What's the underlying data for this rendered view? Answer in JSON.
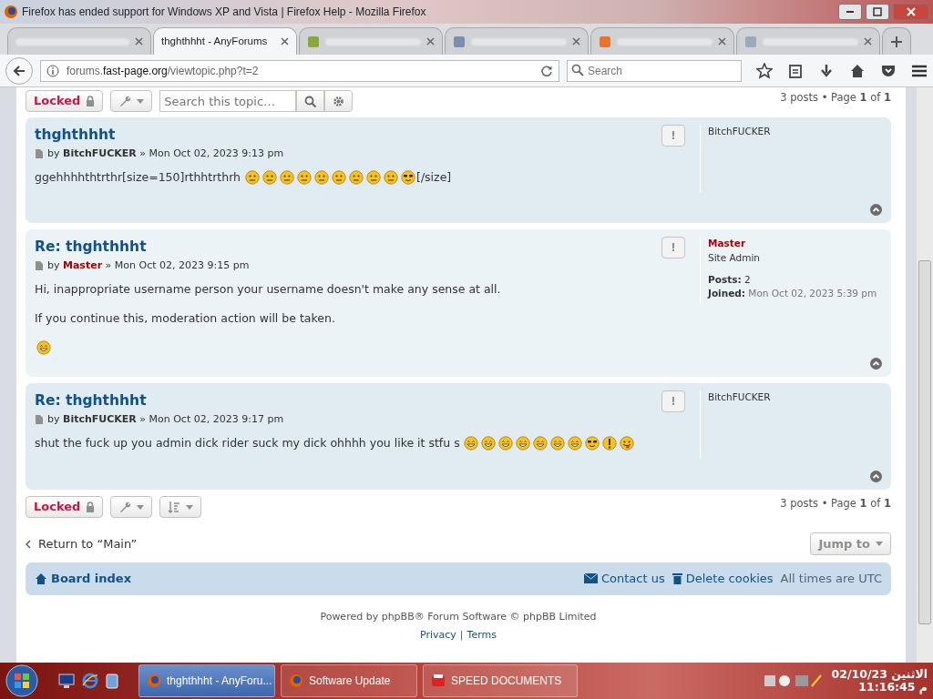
{
  "window": {
    "title": "Firefox has ended support for Windows XP and Vista | Firefox Help - Mozilla Firefox"
  },
  "tabs": [
    {
      "selected": false
    },
    {
      "title": "thghthhht - AnyForums",
      "selected": true
    },
    {
      "selected": false
    },
    {
      "selected": false
    },
    {
      "selected": false
    },
    {
      "selected": false
    }
  ],
  "address": {
    "domain_pre": "forums.",
    "domain": "fast-page.org",
    "path": "/viewtopic.php?t=2"
  },
  "search": {
    "placeholder": "Search"
  },
  "top_actions": {
    "locked": "Locked",
    "search_placeholder": "Search this topic…",
    "pagination": "3 posts • Page **1** of **1**"
  },
  "posts": [
    {
      "title": "thghthhht",
      "report": "!",
      "by_label": "by",
      "author": "BitchFUCKER",
      "admin": false,
      "separator": "»",
      "date": "Mon Oct 02, 2023 9:13 pm",
      "paragraphs": [
        [
          {
            "kind": "text",
            "text": "ggehhhhthtrthr[size=150]rthhtrthrh"
          },
          {
            "kind": "neutral"
          },
          {
            "kind": "neutral"
          },
          {
            "kind": "neutral"
          },
          {
            "kind": "neutral"
          },
          {
            "kind": "neutral"
          },
          {
            "kind": "neutral"
          },
          {
            "kind": "neutral"
          },
          {
            "kind": "neutral"
          },
          {
            "kind": "neutral"
          },
          {
            "kind": "cool"
          },
          {
            "kind": "text",
            "text": "[/size]"
          }
        ]
      ],
      "profile": {
        "name": "BitchFUCKER"
      }
    },
    {
      "title": "Re: thghthhht",
      "report": "!",
      "by_label": "by",
      "author": "Master",
      "admin": true,
      "separator": "»",
      "date": "Mon Oct 02, 2023 9:15 pm",
      "paragraphs": [
        [
          {
            "kind": "text",
            "text": "Hi, inappropriate username person your username doesn't make any sense at all."
          }
        ],
        [
          {
            "kind": "text",
            "text": "If you continue this, moderation action will be taken."
          }
        ],
        [
          {
            "kind": "grin"
          }
        ]
      ],
      "profile": {
        "name": "Master",
        "rank": "Site Admin",
        "posts_label": "Posts:",
        "posts": "2",
        "joined_label": "Joined:",
        "joined": "Mon Oct 02, 2023 5:39 pm"
      }
    },
    {
      "title": "Re: thghthhht",
      "report": "!",
      "by_label": "by",
      "author": "BitchFUCKER",
      "admin": false,
      "separator": "»",
      "date": "Mon Oct 02, 2023 9:17 pm",
      "paragraphs": [
        [
          {
            "kind": "text",
            "text": "shut the fuck up you admin dick rider suck my dick ohhhh you like it stfu s"
          },
          {
            "kind": "grin"
          },
          {
            "kind": "grin"
          },
          {
            "kind": "grin"
          },
          {
            "kind": "grin"
          },
          {
            "kind": "grin"
          },
          {
            "kind": "grin"
          },
          {
            "kind": "grin"
          },
          {
            "kind": "cool"
          },
          {
            "kind": "exclaim"
          },
          {
            "kind": "tongue"
          }
        ]
      ],
      "profile": {
        "name": "BitchFUCKER"
      }
    }
  ],
  "bottom_actions": {
    "locked": "Locked",
    "pagination": "3 posts • Page **1** of **1**"
  },
  "return_link": "Return to “Main”",
  "jump_to": "Jump to",
  "navbar": {
    "board_index": "Board index",
    "contact": "Contact us",
    "delete_cookies": "Delete cookies",
    "timezone": "All times are UTC"
  },
  "footer": {
    "powered": "Powered by phpBB® Forum Software © phpBB Limited",
    "privacy": "Privacy",
    "separator": "|",
    "terms": "Terms"
  },
  "taskbar": {
    "items": [
      {
        "label": "thghthhht - AnyForu...",
        "selected": true,
        "kind": "firefox"
      },
      {
        "label": "Software Update",
        "selected": false,
        "kind": "firefox"
      },
      {
        "label": "SPEED DOCUMENTS",
        "selected": false,
        "kind": "docs"
      }
    ],
    "date": "الاثنين 02/10/23",
    "time": "م 11:16:45"
  }
}
